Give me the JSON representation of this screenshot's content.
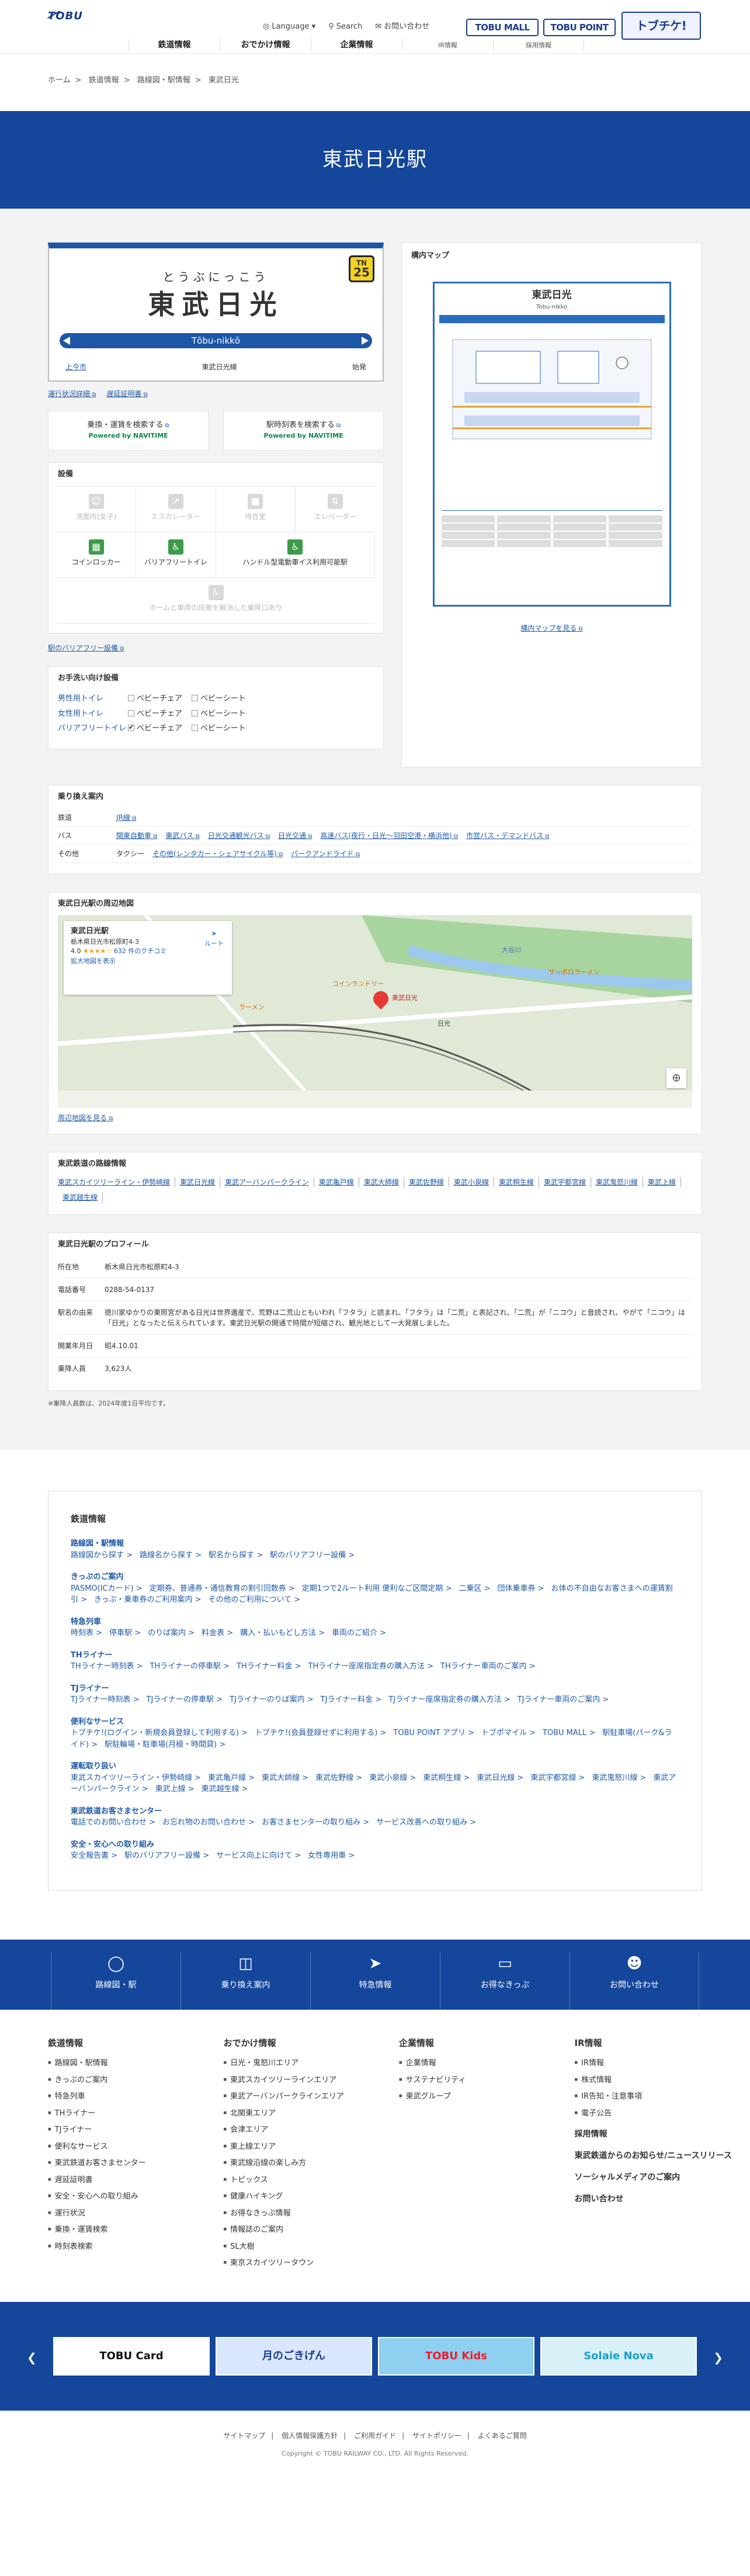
{
  "header": {
    "logo": "TOBU",
    "util": [
      "Language ▾",
      "Search",
      "お問い合わせ"
    ],
    "brands": [
      "TOBU MALL",
      "TOBU POINT",
      "トブチケ!"
    ],
    "nav": [
      {
        "label": "鉄道情報",
        "sub": ""
      },
      {
        "label": "おでかけ情報",
        "sub": ""
      },
      {
        "label": "企業情報",
        "sub": ""
      },
      {
        "label": "",
        "sub": "IR情報"
      },
      {
        "label": "",
        "sub": "採用情報"
      }
    ]
  },
  "breadcrumb": [
    "ホーム",
    "鉄道情報",
    "路線図・駅情報",
    "東武日光"
  ],
  "hero_title": "東武日光駅",
  "sign": {
    "ruby": "とうぶにっこう",
    "kanji": "東武日光",
    "romaji": "Tōbu-nikkō",
    "line_code": "TN",
    "number": "25",
    "left": "上今市",
    "center": "東武日光線",
    "right": "始発"
  },
  "sign_links": [
    "運行状況詳細",
    "遅延証明書"
  ],
  "nav_buttons": [
    {
      "label": "乗換・運賃を検索する",
      "powered": "Powered by NAVITIME"
    },
    {
      "label": "駅時刻表を検索する",
      "powered": "Powered by NAVITIME"
    }
  ],
  "facilities": {
    "title": "設備",
    "items": [
      {
        "label": "洗面所(女子)",
        "on": false
      },
      {
        "label": "エスカレーター",
        "on": false
      },
      {
        "label": "待合室",
        "on": false
      },
      {
        "label": "エレベーター",
        "on": false
      },
      {
        "label": "コインロッカー",
        "on": true
      },
      {
        "label": "バリアフリートイレ",
        "on": true
      },
      {
        "label": "ハンドル型電動車イス利用可能駅",
        "on": true,
        "wide": true
      },
      {
        "label": "ホームと車両の段差を解消した乗降口あり",
        "on": false,
        "full": true
      }
    ],
    "link": "駅のバリアフリー設備"
  },
  "toilets": {
    "title": "お手洗い向け設備",
    "rows": [
      {
        "name": "男性用トイレ",
        "opts": [
          {
            "t": "ベビーチェア",
            "c": false
          },
          {
            "t": "ベビーシート",
            "c": false
          }
        ]
      },
      {
        "name": "女性用トイレ",
        "opts": [
          {
            "t": "ベビーチェア",
            "c": false
          },
          {
            "t": "ベビーシート",
            "c": false
          }
        ]
      },
      {
        "name": "バリアフリートイレ",
        "opts": [
          {
            "t": "ベビーチェア",
            "c": true
          },
          {
            "t": "ベビーシート",
            "c": false
          }
        ]
      }
    ]
  },
  "yard": {
    "title": "構内マップ",
    "map_title": "東武日光",
    "map_sub": "Tobu-nikko",
    "link": "構内マップを見る"
  },
  "transfer": {
    "title": "乗り換え案内",
    "rows": [
      {
        "k": "鉄道",
        "v": [
          "JR線"
        ]
      },
      {
        "k": "バス",
        "v": [
          "関東自動車",
          "東武バス",
          "日光交通観光バス",
          "日光交通",
          "高速バス(夜行・日光〜羽田空港・横浜他)",
          "市営バス・デマンドバス"
        ]
      },
      {
        "k": "その他",
        "v": [
          "タクシー",
          "その他(レンタカー・シェアサイクル等)",
          "パークアンドライド"
        ]
      }
    ]
  },
  "gmap": {
    "title": "東武日光駅の周辺地図",
    "place": "東武日光駅",
    "addr": "栃木県日光市松原町4-3",
    "rating": "4.0",
    "reviews": "632 件のクチコミ",
    "enlarge": "拡大地図を表示",
    "route": "ルート",
    "link": "周辺地図を見る",
    "labels": [
      "東武日光",
      "日光",
      "大谷川",
      "コインランドリー",
      "ラーメン",
      "サッポロラーメン"
    ]
  },
  "lines": {
    "title": "東武鉄道の路線情報",
    "items": [
      "東武スカイツリーライン・伊勢崎線",
      "東武日光線",
      "東武アーバンパークライン",
      "東武亀戸線",
      "東武大師線",
      "東武佐野線",
      "東武小泉線",
      "東武桐生線",
      "東武宇都宮線",
      "東武鬼怒川線",
      "東武上線",
      "東武越生線"
    ]
  },
  "profile": {
    "title": "東武日光駅のプロフィール",
    "rows": [
      {
        "k": "所在地",
        "v": "栃木県日光市松原町4-3"
      },
      {
        "k": "電話番号",
        "v": "0288-54-0137"
      },
      {
        "k": "駅名の由来",
        "v": "徳川家ゆかりの東照宮がある日光は世界遺産で、荒野は二荒山ともいわれ「フタラ」と読まれ、「フタラ」は「二荒」と表記され、「二荒」が「ニコウ」と音読され、やがて「ニコウ」は「日光」となったと伝えられています。東武日光駅の開通で時間が短縮され、観光地として一大発展しました。"
      },
      {
        "k": "開業年月日",
        "v": "昭4.10.01"
      },
      {
        "k": "乗降人員",
        "v": "3,623人"
      }
    ],
    "note": "※乗降人員数は、2024年度1日平均です。"
  },
  "sitenav": {
    "title": "鉄道情報",
    "groups": [
      {
        "h": "路線図・駅情報",
        "l": [
          "路線図から探す",
          "路線名から探す",
          "駅名から探す",
          "駅のバリアフリー設備"
        ]
      },
      {
        "h": "きっぷのご案内",
        "l": [
          "PASMO(ICカード)",
          "定期券、普通券・通信教育の割引回数券",
          "定期1つで2ルート利用 便利なご区間定期",
          "二乗区",
          "団体乗車券",
          "お体の不自由なお客さまへの運賃割引",
          "きっぷ・乗車券のご利用案内",
          "その他のご利用について"
        ]
      },
      {
        "h": "特急列車",
        "l": [
          "時刻表",
          "停車駅",
          "のりば案内",
          "料金表",
          "購入・払いもどし方法",
          "車両のご紹介"
        ]
      },
      {
        "h": "THライナー",
        "l": [
          "THライナー時刻表",
          "THライナーの停車駅",
          "THライナー料金",
          "THライナー座席指定券の購入方法",
          "THライナー車両のご案内"
        ]
      },
      {
        "h": "TJライナー",
        "l": [
          "TJライナー時刻表",
          "TJライナーの停車駅",
          "TJライナーのりば案内",
          "TJライナー料金",
          "TJライナー座席指定券の購入方法",
          "TJライナー車両のご案内"
        ]
      },
      {
        "h": "便利なサービス",
        "l": [
          "トブチケ!(ログイン・新規会員登録して利用する)",
          "トブチケ!(会員登録せずに利用する)",
          "TOBU POINT アプリ",
          "トブポマイル",
          "TOBU MALL",
          "駅駐車場(パーク&ライド)",
          "駅駐輪場・駐車場(月極・時間貸)"
        ]
      },
      {
        "h": "運転取り扱い",
        "l": [
          "東武スカイツリーライン・伊勢崎線",
          "東武亀戸線",
          "東武大師線",
          "東武佐野線",
          "東武小泉線",
          "東武桐生線",
          "東武日光線",
          "東武宇都宮線",
          "東武鬼怒川線",
          "東武アーバンパークライン",
          "東武上線",
          "東武越生線"
        ]
      },
      {
        "h": "東武鉄道お客さまセンター",
        "l": [
          "電話でのお問い合わせ",
          "お忘れ物のお問い合わせ",
          "お客さまセンターの取り組み",
          "サービス改善への取り組み"
        ]
      },
      {
        "h": "安全・安心への取り組み",
        "l": [
          "安全報告書",
          "駅のバリアフリー設備",
          "サービス向上に向けて",
          "女性専用車"
        ]
      }
    ]
  },
  "band": [
    "路線図・駅",
    "乗り換え案内",
    "特急情報",
    "お得なきっぷ",
    "お問い合わせ"
  ],
  "footer": {
    "cols": [
      {
        "h": "鉄道情報",
        "items": [
          "路線図・駅情報",
          "きっぷのご案内",
          "特急列車",
          "THライナー",
          "TJライナー",
          "便利なサービス",
          "東武鉄道お客さまセンター",
          "遅延証明書",
          "安全・安心への取り組み",
          "運行状況",
          "乗換・運賃検索",
          "時刻表検索"
        ]
      },
      {
        "h": "おでかけ情報",
        "items": [
          "日光・鬼怒川エリア",
          "東武スカイツリーラインエリア",
          "東武アーバンパークラインエリア",
          "北関東エリア",
          "会津エリア",
          "東上線エリア",
          "東武線沿線の楽しみ方",
          "トピックス",
          "健康ハイキング",
          "お得なきっぷ情報",
          "情報誌のご案内",
          "SL大樹",
          "東京スカイツリータウン"
        ]
      },
      {
        "h": "企業情報",
        "items": [
          "企業情報",
          "サステナビリティ",
          "東武グループ"
        ]
      },
      {
        "h": "IR情報",
        "items": [
          "IR情報",
          "株式情報",
          "IR告知・注意事項",
          "電子公告"
        ],
        "extra": [
          "採用情報",
          "東武鉄道からのお知らせ/ニュースリリース",
          "ソーシャルメディアのご案内",
          "お問い合わせ"
        ]
      }
    ]
  },
  "banners": [
    "TOBU Card",
    "月のごきげん",
    "TOBU Kids",
    "Solaie Nova"
  ],
  "bottom": {
    "links": [
      "サイトマップ",
      "個人情報保護方針",
      "ご利用ガイド",
      "サイトポリシー",
      "よくあるご質問"
    ],
    "copyright": "Copyright © TOBU RAILWAY CO., LTD. All Rights Reserved."
  }
}
